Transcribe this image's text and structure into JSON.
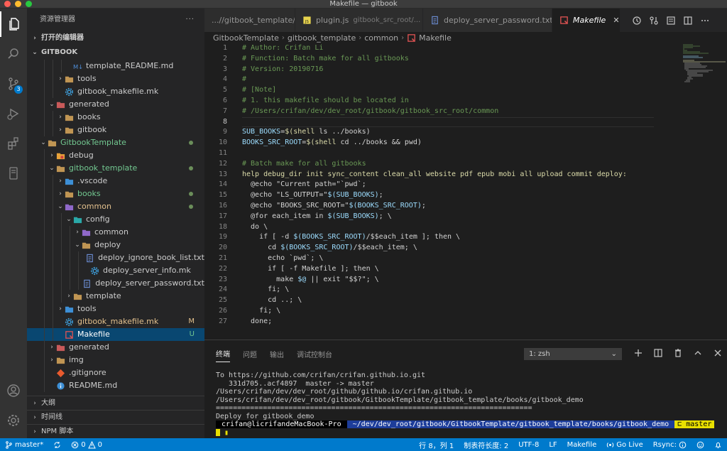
{
  "window": {
    "title": "Makefile — gitbook"
  },
  "activity": {
    "scm_badge": "3"
  },
  "sidebar": {
    "title": "资源管理器",
    "more": "···",
    "open_editors": "打开的编辑器",
    "root": "GITBOOK",
    "tree": [
      {
        "label": "template_README.md",
        "depth": 4,
        "icon": "markdown-icon",
        "type": "file",
        "color": "#cccccc"
      },
      {
        "label": "tools",
        "depth": 3,
        "icon": "folder-icon",
        "type": "folder",
        "chev": "›",
        "color": "#cccccc"
      },
      {
        "label": "gitbook_makefile.mk",
        "depth": 3,
        "icon": "gear-icon",
        "type": "file",
        "color": "#cccccc"
      },
      {
        "label": "generated",
        "depth": 2,
        "icon": "folder-red-icon",
        "type": "folder",
        "chev": "⌄",
        "color": "#cccccc"
      },
      {
        "label": "books",
        "depth": 3,
        "icon": "folder-icon",
        "type": "folder",
        "chev": "›",
        "color": "#cccccc"
      },
      {
        "label": "gitbook",
        "depth": 3,
        "icon": "folder-icon",
        "type": "folder",
        "chev": "›",
        "color": "#cccccc"
      },
      {
        "label": "GitbookTemplate",
        "depth": 1,
        "icon": "folder-icon",
        "type": "folder",
        "chev": "⌄",
        "color": "#73c991",
        "dot": true
      },
      {
        "label": "debug",
        "depth": 2,
        "icon": "folder-orange-icon",
        "type": "folder",
        "chev": "›",
        "color": "#cccccc"
      },
      {
        "label": "gitbook_template",
        "depth": 2,
        "icon": "folder-icon",
        "type": "folder",
        "chev": "⌄",
        "color": "#73c991",
        "dot": true
      },
      {
        "label": ".vscode",
        "depth": 3,
        "icon": "folder-blue-icon",
        "type": "folder",
        "chev": "›",
        "color": "#cccccc"
      },
      {
        "label": "books",
        "depth": 3,
        "icon": "folder-icon",
        "type": "folder",
        "chev": "›",
        "color": "#73c991",
        "dot": true
      },
      {
        "label": "common",
        "depth": 3,
        "icon": "folder-purple-icon",
        "type": "folder",
        "chev": "⌄",
        "color": "#e2c08d",
        "dot": true
      },
      {
        "label": "config",
        "depth": 4,
        "icon": "folder-teal-icon",
        "type": "folder",
        "chev": "⌄",
        "color": "#cccccc"
      },
      {
        "label": "common",
        "depth": 5,
        "icon": "folder-purple-icon",
        "type": "folder",
        "chev": "›",
        "color": "#cccccc"
      },
      {
        "label": "deploy",
        "depth": 5,
        "icon": "folder-icon",
        "type": "folder",
        "chev": "⌄",
        "color": "#cccccc"
      },
      {
        "label": "deploy_ignore_book_list.txt",
        "depth": 6,
        "icon": "text-file-icon",
        "type": "file",
        "color": "#cccccc"
      },
      {
        "label": "deploy_server_info.mk",
        "depth": 6,
        "icon": "gear-icon",
        "type": "file",
        "color": "#cccccc"
      },
      {
        "label": "deploy_server_password.txt",
        "depth": 6,
        "icon": "text-file-icon",
        "type": "file",
        "color": "#cccccc"
      },
      {
        "label": "template",
        "depth": 4,
        "icon": "folder-icon",
        "type": "folder",
        "chev": "›",
        "color": "#cccccc"
      },
      {
        "label": "tools",
        "depth": 3,
        "icon": "folder-blue-icon",
        "type": "folder",
        "chev": "›",
        "color": "#cccccc"
      },
      {
        "label": "gitbook_makefile.mk",
        "depth": 3,
        "icon": "gear-icon",
        "type": "file",
        "color": "#e2c08d",
        "status": "M"
      },
      {
        "label": "Makefile",
        "depth": 3,
        "icon": "makefile-icon",
        "type": "file",
        "color": "#ffffff",
        "status": "U",
        "selected": true
      },
      {
        "label": "generated",
        "depth": 2,
        "icon": "folder-red-icon",
        "type": "folder",
        "chev": "›",
        "color": "#cccccc"
      },
      {
        "label": "img",
        "depth": 2,
        "icon": "folder-icon",
        "type": "folder",
        "chev": "›",
        "color": "#cccccc"
      },
      {
        "label": ".gitignore",
        "depth": 2,
        "icon": "git-icon",
        "type": "file",
        "color": "#cccccc"
      },
      {
        "label": "README.md",
        "depth": 2,
        "icon": "info-icon",
        "type": "file",
        "color": "#cccccc"
      }
    ],
    "bottom": [
      "大纲",
      "时间线",
      "NPM 脚本"
    ]
  },
  "tabs": [
    {
      "label": "...//gitbook_template/...",
      "sub": "",
      "icon": "",
      "pinned": true
    },
    {
      "label": "plugin.js",
      "sub": "gitbook_src_root/...",
      "icon": "js-icon"
    },
    {
      "label": "deploy_server_password.txt",
      "sub": "",
      "icon": "text-file-icon"
    },
    {
      "label": "Makefile",
      "sub": "",
      "icon": "makefile-icon",
      "active": true,
      "close": "✕"
    }
  ],
  "breadcrumb": [
    "GitbookTemplate",
    "gitbook_template",
    "common",
    "Makefile"
  ],
  "editor": {
    "current_line": 8,
    "lines": [
      [
        [
          "c-com",
          "# Author: Crifan Li"
        ]
      ],
      [
        [
          "c-com",
          "# Function: Batch make for all gitbooks"
        ]
      ],
      [
        [
          "c-com",
          "# Version: 20190716"
        ]
      ],
      [
        [
          "c-com",
          "#"
        ]
      ],
      [
        [
          "c-com",
          "# [Note]"
        ]
      ],
      [
        [
          "c-com",
          "# 1. this makefile should be located in"
        ]
      ],
      [
        [
          "c-com",
          "# /Users/crifan/dev/dev_root/gitbook/gitbook_src_root/common"
        ]
      ],
      [
        [
          "c-txt",
          ""
        ]
      ],
      [
        [
          "c-var",
          "SUB_BOOKS"
        ],
        [
          "c-txt",
          "="
        ],
        [
          "c-kw",
          "$(shell"
        ],
        [
          "c-txt",
          " ls ../books)"
        ]
      ],
      [
        [
          "c-var",
          "BOOKS_SRC_ROOT"
        ],
        [
          "c-txt",
          "="
        ],
        [
          "c-kw",
          "$(shell"
        ],
        [
          "c-txt",
          " cd ../books && pwd)"
        ]
      ],
      [
        [
          "c-txt",
          ""
        ]
      ],
      [
        [
          "c-com",
          "# Batch make for all gitbooks"
        ]
      ],
      [
        [
          "c-fn",
          "help debug_dir init sync_content clean_all website pdf epub mobi all upload commit deploy:"
        ]
      ],
      [
        [
          "c-txt",
          "  @echo \"Current path=\"`pwd`;"
        ]
      ],
      [
        [
          "c-txt",
          "  @echo \"LS_OUTPUT=\""
        ],
        [
          "c-var",
          "$(SUB_BOOKS)"
        ],
        [
          "c-txt",
          ";"
        ]
      ],
      [
        [
          "c-txt",
          "  @echo \"BOOKS_SRC_ROOT=\""
        ],
        [
          "c-var",
          "$(BOOKS_SRC_ROOT)"
        ],
        [
          "c-txt",
          ";"
        ]
      ],
      [
        [
          "c-txt",
          "  @for each_item in "
        ],
        [
          "c-var",
          "$(SUB_BOOKS)"
        ],
        [
          "c-txt",
          "; \\"
        ]
      ],
      [
        [
          "c-txt",
          "  do \\"
        ]
      ],
      [
        [
          "c-txt",
          "    if [ -d "
        ],
        [
          "c-var",
          "$(BOOKS_SRC_ROOT)"
        ],
        [
          "c-txt",
          "/$$each_item ]; then \\"
        ]
      ],
      [
        [
          "c-txt",
          "      cd "
        ],
        [
          "c-var",
          "$(BOOKS_SRC_ROOT)"
        ],
        [
          "c-txt",
          "/$$each_item; \\"
        ]
      ],
      [
        [
          "c-txt",
          "      echo `pwd`; \\"
        ]
      ],
      [
        [
          "c-txt",
          "      if [ -f Makefile ]; then \\"
        ]
      ],
      [
        [
          "c-txt",
          "        make "
        ],
        [
          "c-var",
          "$@"
        ],
        [
          "c-txt",
          " || exit \"$$?\"; \\"
        ]
      ],
      [
        [
          "c-txt",
          "      fi; \\"
        ]
      ],
      [
        [
          "c-txt",
          "      cd ..; \\"
        ]
      ],
      [
        [
          "c-txt",
          "    fi; \\"
        ]
      ],
      [
        [
          "c-txt",
          "  done;"
        ]
      ]
    ]
  },
  "panel": {
    "tabs": [
      "终端",
      "问题",
      "输出",
      "调试控制台"
    ],
    "active_tab": 0,
    "terminal_select": "1: zsh",
    "terminal_lines": [
      "To https://github.com/crifan/crifan.github.io.git",
      "   331d705..acf4897  master -> master",
      "/Users/crifan/dev/dev_root/github/github.io/crifan.github.io",
      "/Users/crifan/dev/dev_root/gitbook/GitbookTemplate/gitbook_template/books/gitbook_demo",
      "==========================================================================",
      "Deploy for gitbook_demo"
    ],
    "prompt": {
      "user": " crifan@licrifandeMacBook-Pro ",
      "path": " ~/dev/dev_root/gitbook/GitbookTemplate/gitbook_template/books/gitbook_demo ",
      "branch": "master"
    }
  },
  "statusbar": {
    "branch": "master*",
    "errors": "0",
    "warnings": "0",
    "position": "行 8，列 1",
    "indent": "制表符长度: 2",
    "encoding": "UTF-8",
    "eol": "LF",
    "language": "Makefile",
    "golive": "Go Live",
    "rsync": "Rsync:"
  },
  "colors": {
    "accent": "#007acc",
    "git_added": "#73c991",
    "git_modified": "#e2c08d"
  }
}
